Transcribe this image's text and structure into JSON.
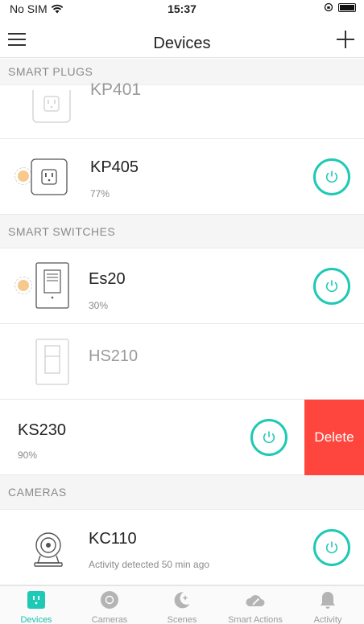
{
  "status_bar": {
    "carrier": "No SIM",
    "time": "15:37"
  },
  "nav": {
    "title": "Devices"
  },
  "sections": {
    "smart_plugs": "SMART PLUGS",
    "smart_switches": "SMART SWITCHES",
    "cameras": "CAMERAS"
  },
  "devices": {
    "kp401": {
      "name": "KP401"
    },
    "kp405": {
      "name": "KP405",
      "status": "77%"
    },
    "es20": {
      "name": "Es20",
      "status": "30%"
    },
    "hs210": {
      "name": "HS210"
    },
    "ks230": {
      "name": "KS230",
      "status": "90%",
      "delete_label": "Delete"
    },
    "kc110": {
      "name": "KC110",
      "status": "Activity detected 50 min ago"
    }
  },
  "tabs": [
    {
      "label": "Devices",
      "icon": "plug-icon",
      "active": true
    },
    {
      "label": "Cameras",
      "icon": "camera-lens-icon",
      "active": false
    },
    {
      "label": "Scenes",
      "icon": "moon-stars-icon",
      "active": false
    },
    {
      "label": "Smart Actions",
      "icon": "cloud-wand-icon",
      "active": false
    },
    {
      "label": "Activity",
      "icon": "bell-icon",
      "active": false
    }
  ],
  "colors": {
    "accent": "#1EC9B5",
    "delete": "#FF463E",
    "glow": "#F8C98C"
  }
}
